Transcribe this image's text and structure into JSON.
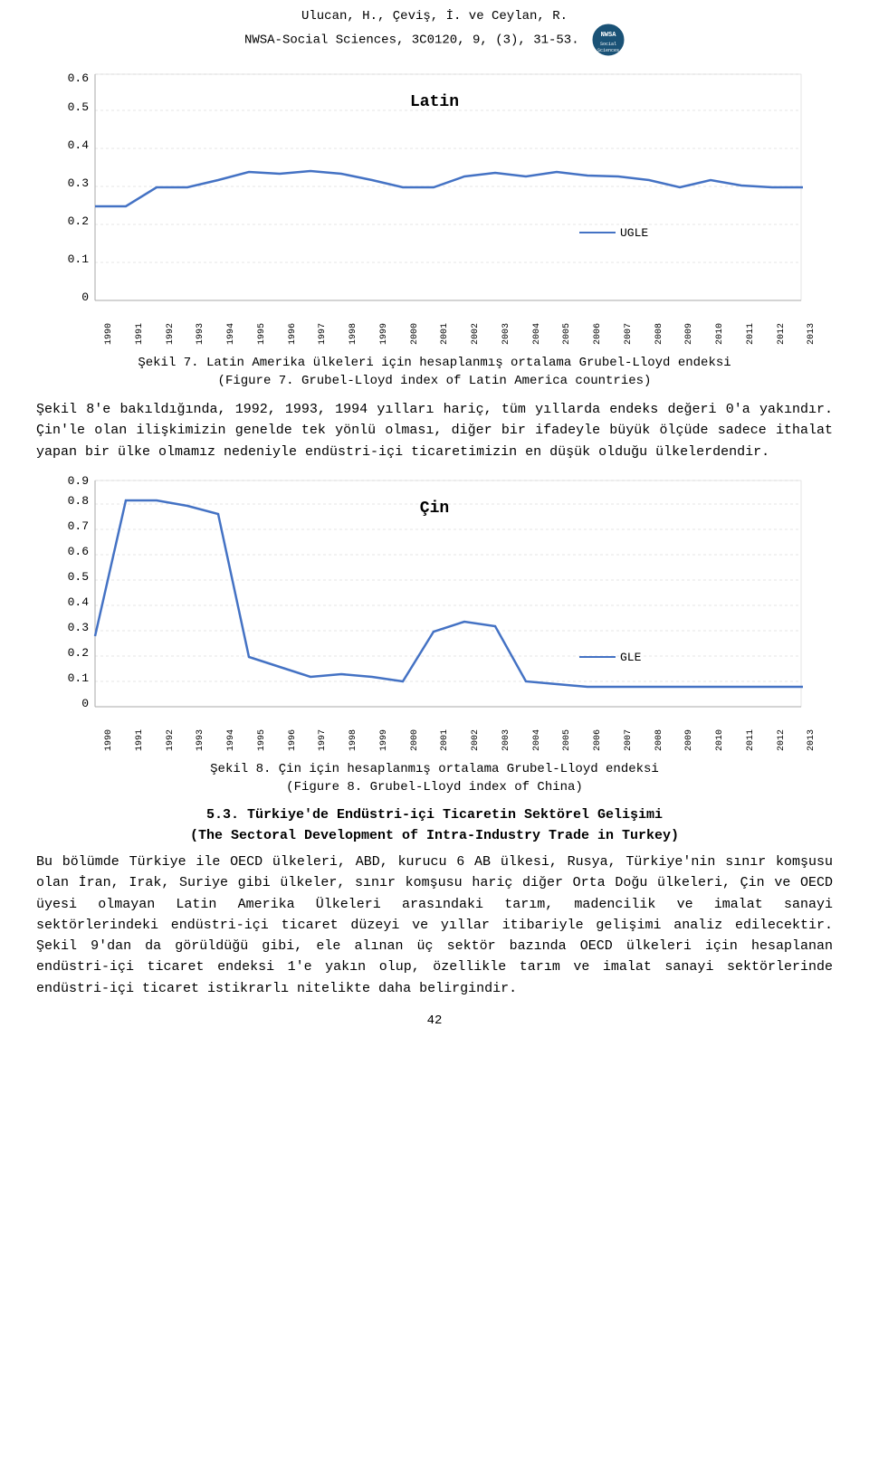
{
  "header": {
    "line1": "Ulucan, H., Çeviş, İ. ve Ceylan, R.",
    "line2": "NWSA-Social Sciences, 3C0120, 9, (3), 31-53."
  },
  "chart1": {
    "title": "Latin",
    "legend": "UGLE",
    "caption_line1": "Şekil 7. Latin Amerika ülkeleri için hesaplanmış ortalama Grubel-Lloyd endeksi",
    "caption_line2": "(Figure 7. Grubel-Lloyd index of Latin America countries)"
  },
  "paragraph1": "Şekil 8'e bakıldığında, 1992, 1993, 1994 yılları hariç, tüm yıllarda endeks değeri 0'a yakındır. Çin'le olan ilişkimizin genelde tek yönlü olması, diğer bir ifadeyle büyük ölçüde sadece ithalat yapan bir ülke olmamız nedeniyle endüstri-içi ticaretimizin en düşük olduğu ülkelerdendir.",
  "chart2": {
    "title": "Çin",
    "legend": "GLE",
    "caption_line1": "Şekil 8. Çin için hesaplanmış ortalama Grubel-Lloyd endeksi",
    "caption_line2": "(Figure 8. Grubel-Lloyd index of China)"
  },
  "section_heading": {
    "line1": "5.3. Türkiye'de Endüstri-içi Ticaretin Sektörel Gelişimi",
    "line2": "(The Sectoral Development of Intra-Industry Trade in Turkey)"
  },
  "paragraph2": "Bu bölümde Türkiye ile OECD ülkeleri, ABD, kurucu 6 AB ülkesi, Rusya, Türkiye'nin sınır komşusu olan İran, Irak, Suriye gibi ülkeler, sınır komşusu hariç diğer Orta Doğu ülkeleri, Çin ve OECD üyesi olmayan Latin Amerika Ülkeleri arasındaki tarım, madencilik ve imalat sanayi sektörlerindeki endüstri-içi ticaret düzeyi ve yıllar itibariyle gelişimi analiz edilecektir. Şekil 9'dan da görüldüğü gibi, ele alınan üç sektör bazında OECD ülkeleri için hesaplanan endüstri-içi ticaret endeksi 1'e yakın olup, özellikle tarım ve imalat sanayi sektörlerinde endüstri-içi ticaret istikrarlı nitelikte daha belirgindir.",
  "page_number": "42",
  "years": [
    "1990",
    "1991",
    "1992",
    "1993",
    "1994",
    "1995",
    "1996",
    "1997",
    "1998",
    "1999",
    "2000",
    "2001",
    "2002",
    "2003",
    "2004",
    "2005",
    "2006",
    "2007",
    "2008",
    "2009",
    "2010",
    "2011",
    "2012",
    "2013"
  ]
}
